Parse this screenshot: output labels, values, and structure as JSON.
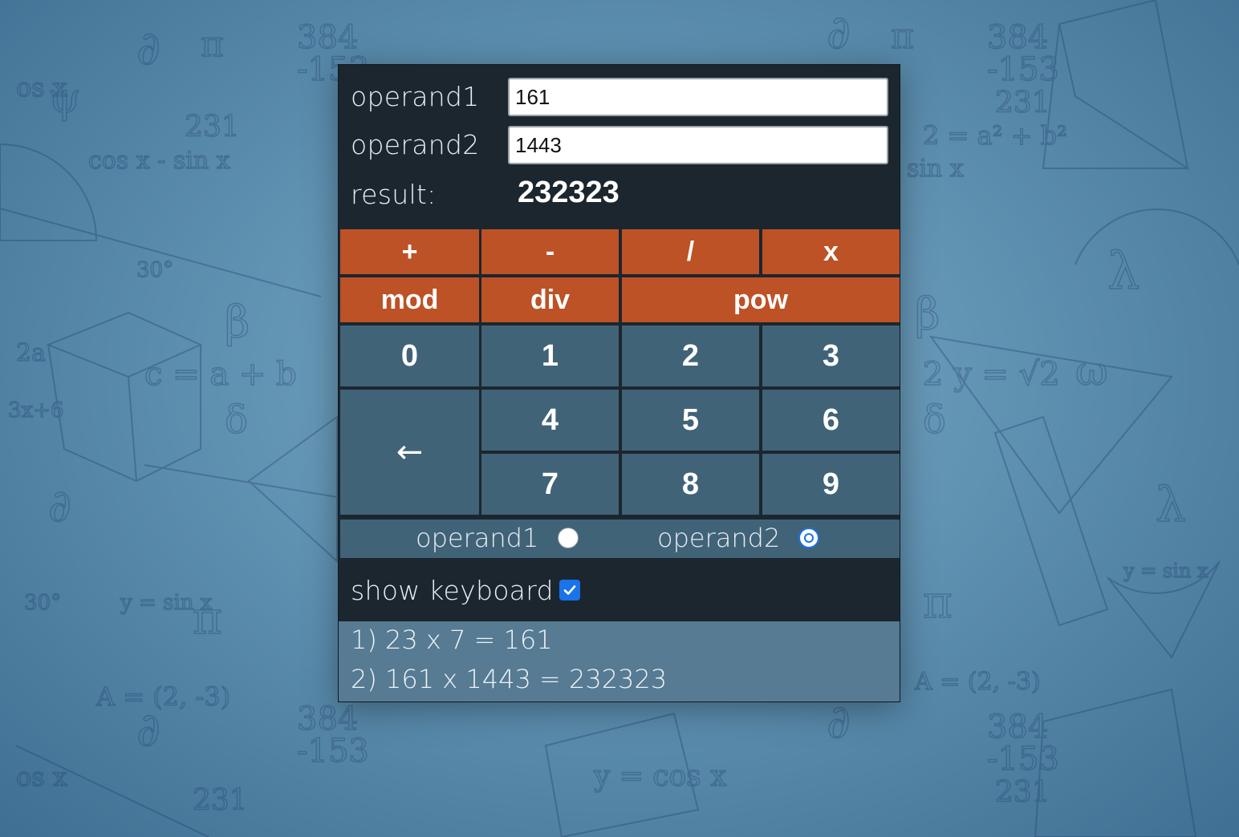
{
  "fields": {
    "operand1_label": "operand1",
    "operand1_value": "161",
    "operand2_label": "operand2",
    "operand2_value": "1443",
    "result_label": "result:",
    "result_value": "232323"
  },
  "operations": {
    "add": "+",
    "subtract": "-",
    "divide": "/",
    "multiply": "x",
    "mod": "mod",
    "div": "div",
    "pow": "pow"
  },
  "keypad": {
    "k0": "0",
    "k1": "1",
    "k2": "2",
    "k3": "3",
    "k4": "4",
    "k5": "5",
    "k6": "6",
    "k7": "7",
    "k8": "8",
    "k9": "9",
    "backspace": "←"
  },
  "target_selector": {
    "option1_label": "operand1",
    "option2_label": "operand2",
    "selected": "operand2"
  },
  "keyboard_toggle": {
    "label": "show keyboard",
    "checked": true
  },
  "history": [
    "1) 23 x 7 = 161",
    "2) 161 x 1443 = 232323"
  ],
  "colors": {
    "panel_bg": "#1c262e",
    "operator_button": "#bc5226",
    "number_button": "#416378",
    "history_bg": "#567b93",
    "accent": "#1a73e8"
  }
}
